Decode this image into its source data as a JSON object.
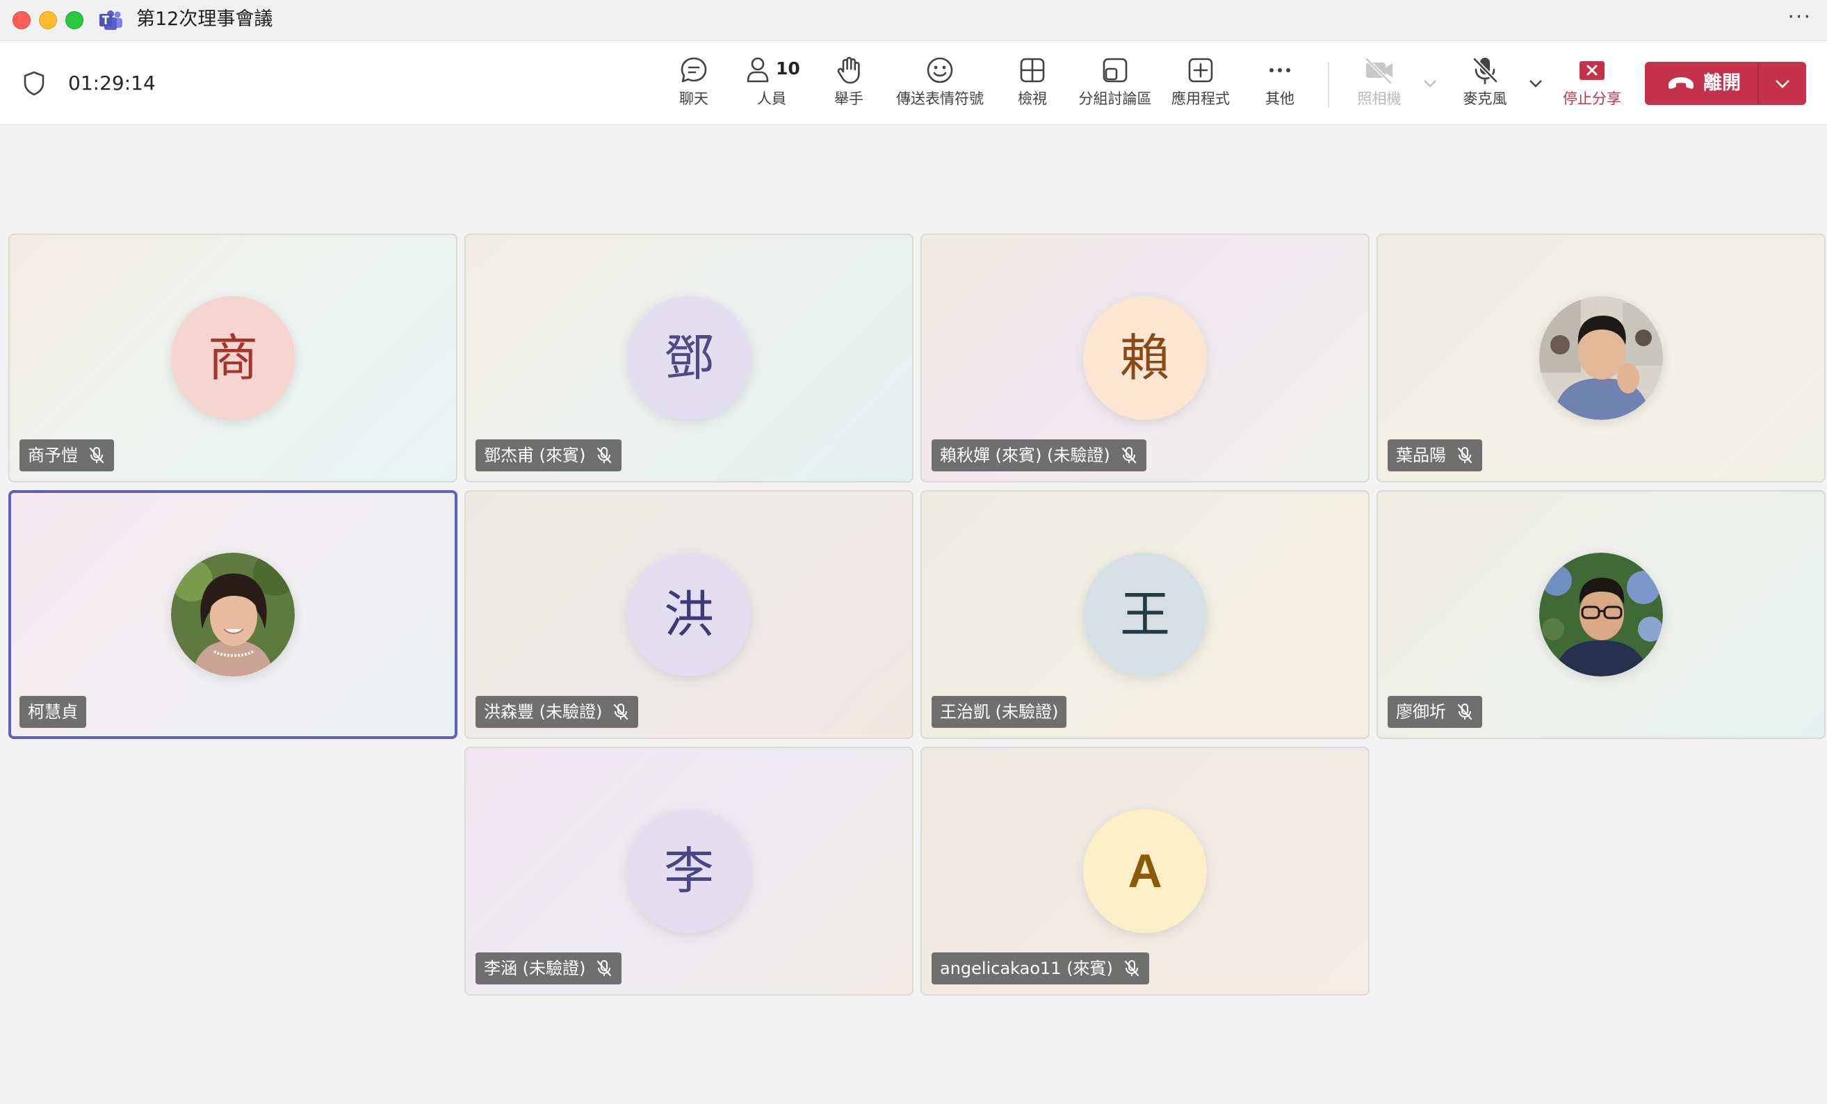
{
  "window": {
    "title": "第12次理事會議",
    "more": "···"
  },
  "toolbar": {
    "timer": "01:29:14",
    "chat": "聊天",
    "people": "人員",
    "people_count": "10",
    "raise_hand": "舉手",
    "reactions": "傳送表情符號",
    "view": "檢視",
    "breakout": "分組討論區",
    "apps": "應用程式",
    "more": "其他",
    "camera": "照相機",
    "mic": "麥克風",
    "stop_share": "停止分享",
    "leave": "離開"
  },
  "colors": {
    "accent": "#5b5fc7",
    "leave_red": "#c4314b",
    "namebar_bg": "#646464"
  },
  "participants": [
    {
      "name": "商予愷",
      "initial": "商",
      "muted": true,
      "avatar_bg": "#f6d5d1",
      "initial_color": "#a3352a"
    },
    {
      "name": "鄧杰甫 (來賓)",
      "initial": "鄧",
      "muted": true,
      "avatar_bg": "#e3def0",
      "initial_color": "#4f4a86"
    },
    {
      "name": "賴秋嬋 (來賓) (未驗證)",
      "initial": "賴",
      "muted": true,
      "avatar_bg": "#fbe6d3",
      "initial_color": "#8a4a15"
    },
    {
      "name": "葉品陽",
      "initial": "",
      "muted": true,
      "avatar": "photo-young-man"
    },
    {
      "name": "柯慧貞",
      "initial": "",
      "muted": false,
      "active_speaker": true,
      "avatar": "photo-woman"
    },
    {
      "name": "洪森豐 (未驗證)",
      "initial": "洪",
      "muted": true,
      "avatar_bg": "#e3def0",
      "initial_color": "#3e3a78"
    },
    {
      "name": "王治凱 (未驗證)",
      "initial": "王",
      "muted": false,
      "avatar_bg": "#d6dfe4",
      "initial_color": "#223c44"
    },
    {
      "name": "廖御圻",
      "initial": "",
      "muted": true,
      "avatar": "photo-man-glasses"
    },
    {
      "name": "李涵 (未驗證)",
      "initial": "李",
      "muted": true,
      "avatar_bg": "#e5def0",
      "initial_color": "#4a4583"
    },
    {
      "name": "angelicakao11 (來賓)",
      "initial": "A",
      "muted": true,
      "avatar_bg": "#fcefc8",
      "initial_color": "#8a5a08"
    }
  ]
}
